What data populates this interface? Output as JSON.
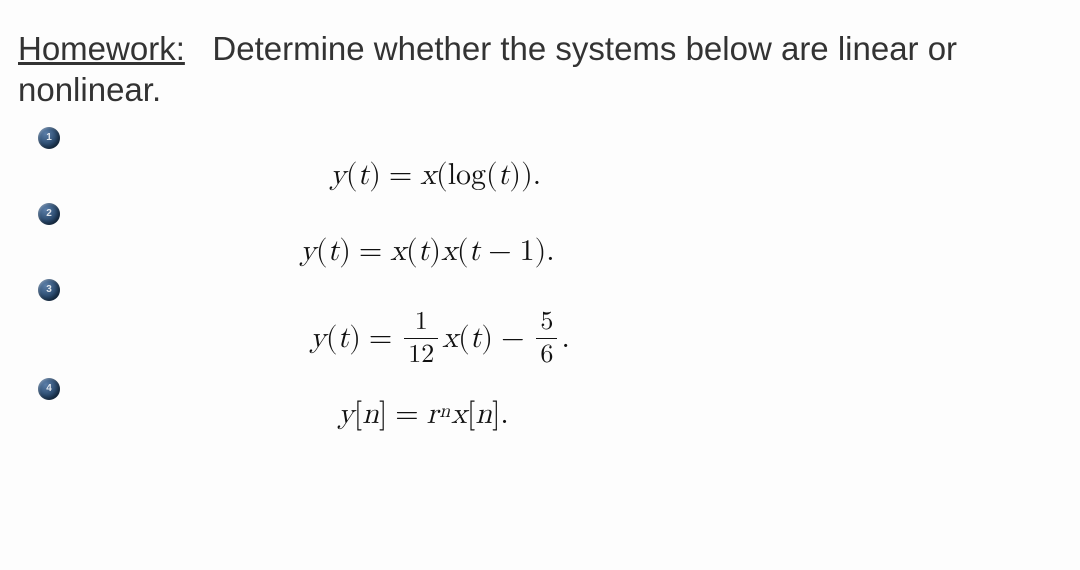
{
  "header": {
    "label": "Homework:",
    "prompt": "Determine whether the systems below are linear or nonlinear."
  },
  "problems": [
    {
      "bullet": "1",
      "y": "y",
      "yarg": "t",
      "eq": "=",
      "r1": "x",
      "r1a": "(log(",
      "r1b": "t",
      "r1c": "))."
    },
    {
      "bullet": "2",
      "y": "y",
      "yarg": "t",
      "eq": "=",
      "r1": "x",
      "r1arg": "t",
      "r2": "x",
      "r2arg_a": "t",
      "minus": "−",
      "r2arg_b": "1",
      "tail": "."
    },
    {
      "bullet": "3",
      "y": "y",
      "yarg": "t",
      "eq": "=",
      "f1n": "1",
      "f1d": "12",
      "x": "x",
      "xarg": "t",
      "minus": "−",
      "f2n": "5",
      "f2d": "6",
      "tail": "."
    },
    {
      "bullet": "4",
      "y": "y",
      "yarg": "n",
      "eq": "=",
      "r": "r",
      "exp": "n",
      "x": "x",
      "xarg": "n",
      "tail": "."
    }
  ]
}
